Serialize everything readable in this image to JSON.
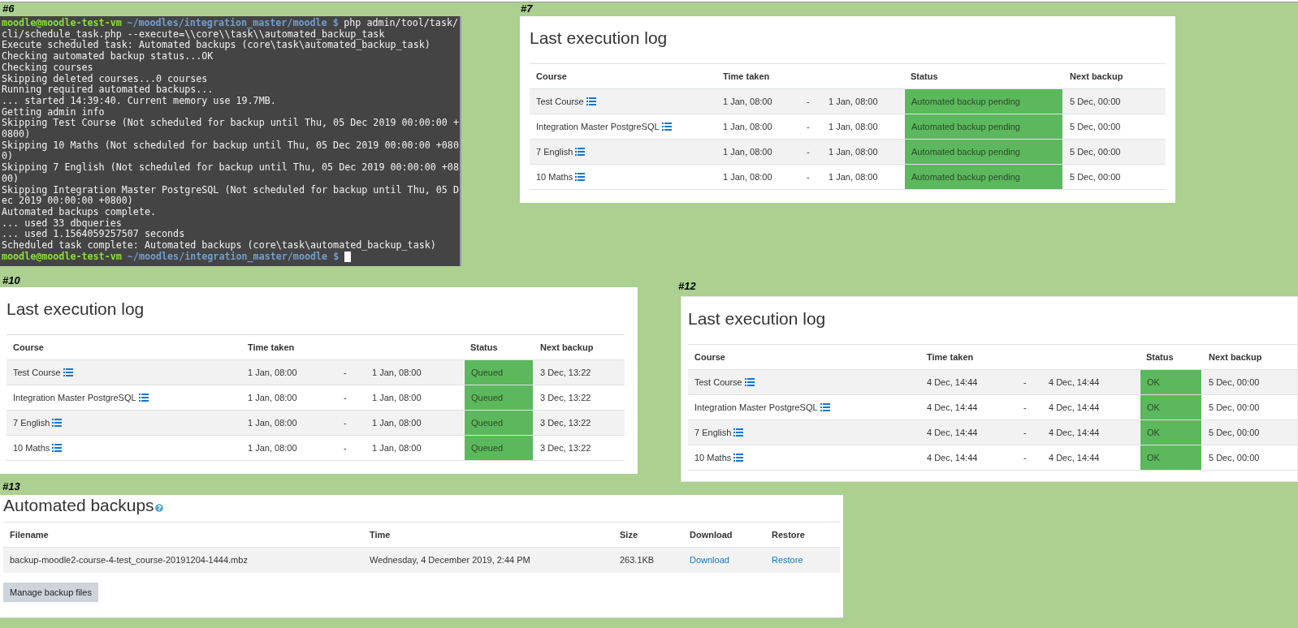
{
  "panels": [
    {
      "kind": "terminal",
      "label": "#6",
      "lines": [
        {
          "kind": "prompt",
          "user": "moodle@moodle-test-vm",
          "path": "~/moodles/integration_master/moodle $",
          "command": "php admin/tool/task/",
          "cursor": false
        },
        {
          "kind": "output",
          "text": "cli/schedule_task.php --execute=\\\\core\\\\task\\\\automated_backup_task"
        },
        {
          "kind": "output",
          "text": "Execute scheduled task: Automated backups (core\\task\\automated_backup_task)"
        },
        {
          "kind": "output",
          "text": "Checking automated backup status...OK"
        },
        {
          "kind": "output",
          "text": "Checking courses"
        },
        {
          "kind": "output",
          "text": "Skipping deleted courses...0 courses"
        },
        {
          "kind": "output",
          "text": "Running required automated backups..."
        },
        {
          "kind": "output",
          "text": "... started 14:39:40. Current memory use 19.7MB."
        },
        {
          "kind": "output",
          "text": "Getting admin info"
        },
        {
          "kind": "output",
          "text": "Skipping Test Course (Not scheduled for backup until Thu, 05 Dec 2019 00:00:00 +"
        },
        {
          "kind": "output",
          "text": "0800)"
        },
        {
          "kind": "output",
          "text": "Skipping 10 Maths (Not scheduled for backup until Thu, 05 Dec 2019 00:00:00 +080"
        },
        {
          "kind": "output",
          "text": "0)"
        },
        {
          "kind": "output",
          "text": "Skipping 7 English (Not scheduled for backup until Thu, 05 Dec 2019 00:00:00 +08"
        },
        {
          "kind": "output",
          "text": "00)"
        },
        {
          "kind": "output",
          "text": "Skipping Integration Master PostgreSQL (Not scheduled for backup until Thu, 05 D"
        },
        {
          "kind": "output",
          "text": "ec 2019 00:00:00 +0800)"
        },
        {
          "kind": "output",
          "text": "Automated backups complete."
        },
        {
          "kind": "output",
          "text": "... used 33 dbqueries"
        },
        {
          "kind": "output",
          "text": "... used 1.1564059257507 seconds"
        },
        {
          "kind": "output",
          "text": "Scheduled task complete: Automated backups (core\\task\\automated_backup_task)"
        },
        {
          "kind": "prompt",
          "user": "moodle@moodle-test-vm",
          "path": "~/moodles/integration_master/moodle $",
          "cursor": true
        }
      ]
    },
    {
      "kind": "log",
      "label": "#7",
      "title": "Last execution log",
      "columns": [
        "Course",
        "Time taken",
        "Status",
        "Next backup"
      ],
      "rows": [
        {
          "course": "Test Course",
          "start": "1 Jan, 08:00",
          "dash": "-",
          "end": "1 Jan, 08:00",
          "status": "Automated backup pending",
          "next": "5 Dec, 00:00"
        },
        {
          "course": "Integration Master PostgreSQL",
          "start": "1 Jan, 08:00",
          "dash": "-",
          "end": "1 Jan, 08:00",
          "status": "Automated backup pending",
          "next": "5 Dec, 00:00"
        },
        {
          "course": "7 English",
          "start": "1 Jan, 08:00",
          "dash": "-",
          "end": "1 Jan, 08:00",
          "status": "Automated backup pending",
          "next": "5 Dec, 00:00"
        },
        {
          "course": "10 Maths",
          "start": "1 Jan, 08:00",
          "dash": "-",
          "end": "1 Jan, 08:00",
          "status": "Automated backup pending",
          "next": "5 Dec, 00:00"
        }
      ]
    },
    {
      "kind": "log",
      "label": "#10",
      "title": "Last execution log",
      "columns": [
        "Course",
        "Time taken",
        "Status",
        "Next backup"
      ],
      "rows": [
        {
          "course": "Test Course",
          "start": "1 Jan, 08:00",
          "dash": "-",
          "end": "1 Jan, 08:00",
          "status": "Queued",
          "next": "3 Dec, 13:22"
        },
        {
          "course": "Integration Master PostgreSQL",
          "start": "1 Jan, 08:00",
          "dash": "-",
          "end": "1 Jan, 08:00",
          "status": "Queued",
          "next": "3 Dec, 13:22"
        },
        {
          "course": "7 English",
          "start": "1 Jan, 08:00",
          "dash": "-",
          "end": "1 Jan, 08:00",
          "status": "Queued",
          "next": "3 Dec, 13:22"
        },
        {
          "course": "10 Maths",
          "start": "1 Jan, 08:00",
          "dash": "-",
          "end": "1 Jan, 08:00",
          "status": "Queued",
          "next": "3 Dec, 13:22"
        }
      ]
    },
    {
      "kind": "log",
      "label": "#12",
      "title": "Last execution log",
      "columns": [
        "Course",
        "Time taken",
        "Status",
        "Next backup"
      ],
      "rows": [
        {
          "course": "Test Course",
          "start": "4 Dec, 14:44",
          "dash": "-",
          "end": "4 Dec, 14:44",
          "status": "OK",
          "next": "5 Dec, 00:00"
        },
        {
          "course": "Integration Master PostgreSQL",
          "start": "4 Dec, 14:44",
          "dash": "-",
          "end": "4 Dec, 14:44",
          "status": "OK",
          "next": "5 Dec, 00:00"
        },
        {
          "course": "7 English",
          "start": "4 Dec, 14:44",
          "dash": "-",
          "end": "4 Dec, 14:44",
          "status": "OK",
          "next": "5 Dec, 00:00"
        },
        {
          "course": "10 Maths",
          "start": "4 Dec, 14:44",
          "dash": "-",
          "end": "4 Dec, 14:44",
          "status": "OK",
          "next": "5 Dec, 00:00"
        }
      ]
    },
    {
      "kind": "backups",
      "label": "#13",
      "title": "Automated backups",
      "columns": [
        "Filename",
        "Time",
        "Size",
        "Download",
        "Restore"
      ],
      "rows": [
        {
          "filename": "backup-moodle2-course-4-test_course-20191204-1444.mbz",
          "time": "Wednesday, 4 December 2019, 2:44 PM",
          "size": "263.1KB",
          "download": "Download",
          "restore": "Restore"
        }
      ],
      "button": "Manage backup files"
    }
  ]
}
